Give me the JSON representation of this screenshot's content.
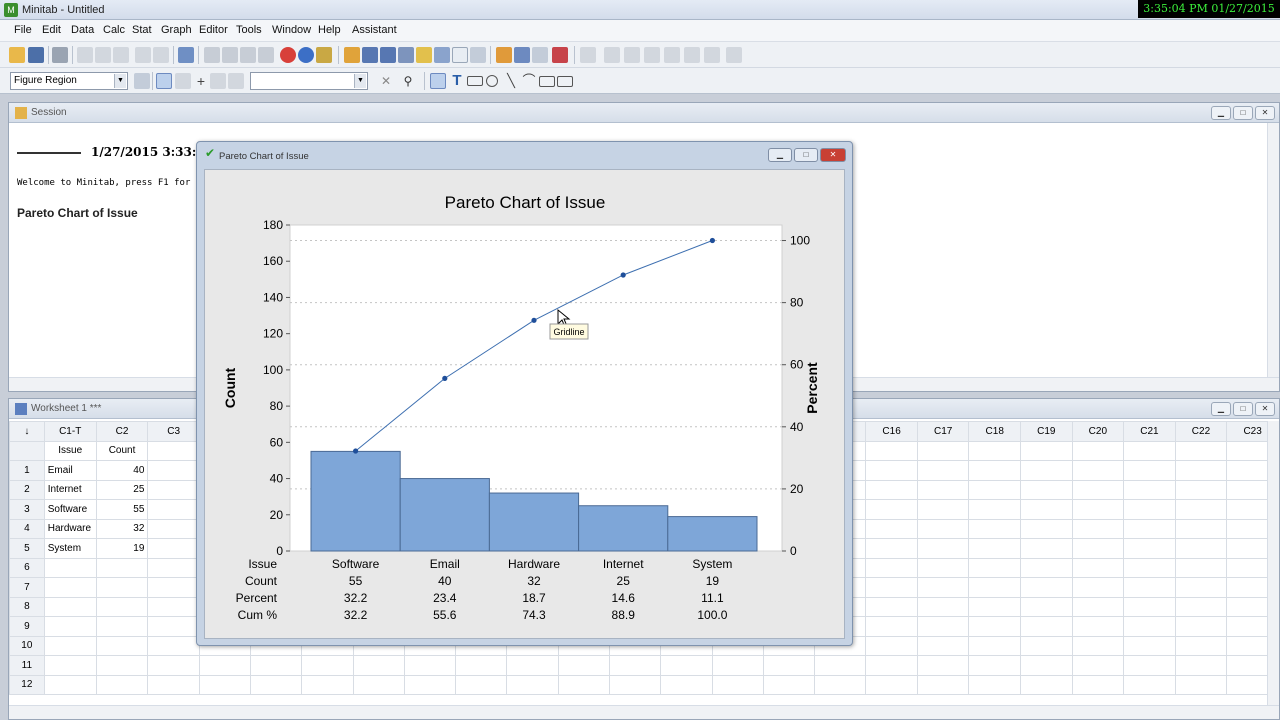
{
  "app": {
    "title": "Minitab - Untitled",
    "clock": "3:35:04 PM 01/27/2015"
  },
  "menu": [
    "File",
    "Edit",
    "Data",
    "Calc",
    "Stat",
    "Graph",
    "Editor",
    "Tools",
    "Window",
    "Help",
    "Assistant"
  ],
  "toolbar": {
    "region_select": "Figure Region",
    "second_select": ""
  },
  "session": {
    "title": "Session",
    "date": "1/27/2015 3:33:5…",
    "welcome": "Welcome to Minitab, press F1 for",
    "heading": "Pareto Chart of Issue"
  },
  "worksheet": {
    "title": "Worksheet 1 ***",
    "columns": [
      "C1-T",
      "C2",
      "C3",
      "",
      "",
      "",
      "",
      "",
      "",
      "",
      "",
      "",
      "",
      "",
      "",
      "",
      "C16",
      "C17",
      "C18",
      "C19",
      "C20",
      "C21",
      "C22",
      "C23"
    ],
    "names": [
      "Issue",
      "Count"
    ],
    "rows": [
      {
        "n": "1",
        "issue": "Email",
        "count": "40"
      },
      {
        "n": "2",
        "issue": "Internet",
        "count": "25"
      },
      {
        "n": "3",
        "issue": "Software",
        "count": "55"
      },
      {
        "n": "4",
        "issue": "Hardware",
        "count": "32"
      },
      {
        "n": "5",
        "issue": "System",
        "count": "19"
      },
      {
        "n": "6",
        "issue": "",
        "count": ""
      },
      {
        "n": "7",
        "issue": "",
        "count": ""
      },
      {
        "n": "8",
        "issue": "",
        "count": ""
      },
      {
        "n": "9",
        "issue": "",
        "count": ""
      },
      {
        "n": "10",
        "issue": "",
        "count": ""
      },
      {
        "n": "11",
        "issue": "",
        "count": ""
      },
      {
        "n": "12",
        "issue": "",
        "count": ""
      }
    ]
  },
  "graph_window": {
    "title": "Pareto Chart of Issue",
    "tooltip": "Gridline"
  },
  "chart_data": {
    "type": "bar",
    "title": "Pareto Chart of Issue",
    "categories": [
      "Software",
      "Email",
      "Hardware",
      "Internet",
      "System"
    ],
    "values": [
      55,
      40,
      32,
      25,
      19
    ],
    "cumulative_percent": [
      32.2,
      55.6,
      74.3,
      88.9,
      100.0
    ],
    "ylabel": "Count",
    "ylabel_right": "Percent",
    "ylim": [
      0,
      180
    ],
    "yticks": [
      0,
      20,
      40,
      60,
      80,
      100,
      120,
      140,
      160,
      180
    ],
    "ylim_right": [
      0,
      105
    ],
    "yticks_right": [
      0,
      20,
      40,
      60,
      80,
      100
    ],
    "bar_color": "#7ea6d8",
    "line_color": "#3d6fb0",
    "grid": true,
    "table": {
      "row_labels": [
        "Issue",
        "Count",
        "Percent",
        "Cum %"
      ],
      "count": [
        "55",
        "40",
        "32",
        "25",
        "19"
      ],
      "percent": [
        "32.2",
        "23.4",
        "18.7",
        "14.6",
        "11.1"
      ],
      "cum": [
        "32.2",
        "55.6",
        "74.3",
        "88.9",
        "100.0"
      ]
    }
  }
}
